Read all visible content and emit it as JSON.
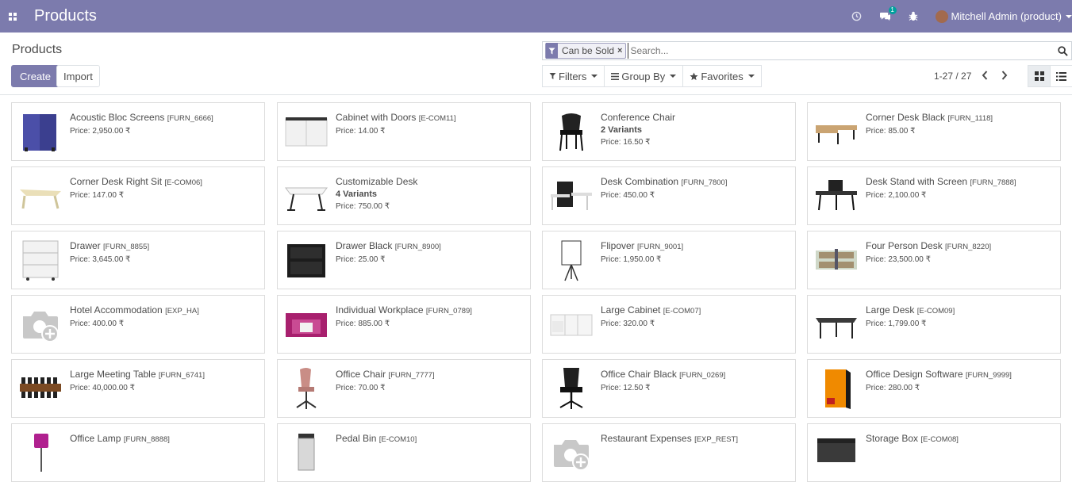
{
  "app_title": "Products",
  "nav": {
    "messages_badge": "1",
    "user_name": "Mitchell Admin (product)"
  },
  "control": {
    "breadcrumb": "Products",
    "create_label": "Create",
    "import_label": "Import",
    "search": {
      "facet_value": "Can be Sold",
      "facet_remove": "×",
      "placeholder": "Search..."
    },
    "filters_label": "Filters",
    "groupby_label": "Group By",
    "favorites_label": "Favorites",
    "pager": "1-27 / 27"
  },
  "colors": {
    "brand": "#7c7bad",
    "text": "#4c4c4c",
    "border": "#dcdcdc"
  },
  "products": [
    {
      "name": "Acoustic Bloc Screens",
      "ref": "[FURN_6666]",
      "variants": "",
      "price": "Price: 2,950.00 ₹",
      "image": "screen-panel"
    },
    {
      "name": "Cabinet with Doors",
      "ref": "[E-COM11]",
      "variants": "",
      "price": "Price: 14.00 ₹",
      "image": "cabinet"
    },
    {
      "name": "Conference Chair",
      "ref": "",
      "variants": "2 Variants",
      "price": "Price: 16.50 ₹",
      "image": "chair-black"
    },
    {
      "name": "Corner Desk Black",
      "ref": "[FURN_1118]",
      "variants": "",
      "price": "Price: 85.00 ₹",
      "image": "desk-wood"
    },
    {
      "name": "Corner Desk Right Sit",
      "ref": "[E-COM06]",
      "variants": "",
      "price": "Price: 147.00 ₹",
      "image": "desk-light"
    },
    {
      "name": "Customizable Desk",
      "ref": "",
      "variants": "4 Variants",
      "price": "Price: 750.00 ₹",
      "image": "desk-white"
    },
    {
      "name": "Desk Combination",
      "ref": "[FURN_7800]",
      "variants": "",
      "price": "Price: 450.00 ₹",
      "image": "desk-combo"
    },
    {
      "name": "Desk Stand with Screen",
      "ref": "[FURN_7888]",
      "variants": "",
      "price": "Price: 2,100.00 ₹",
      "image": "desk-screen"
    },
    {
      "name": "Drawer",
      "ref": "[FURN_8855]",
      "variants": "",
      "price": "Price: 3,645.00 ₹",
      "image": "drawer-white"
    },
    {
      "name": "Drawer Black",
      "ref": "[FURN_8900]",
      "variants": "",
      "price": "Price: 25.00 ₹",
      "image": "drawer-black"
    },
    {
      "name": "Flipover",
      "ref": "[FURN_9001]",
      "variants": "",
      "price": "Price: 1,950.00 ₹",
      "image": "flipover"
    },
    {
      "name": "Four Person Desk",
      "ref": "[FURN_8220]",
      "variants": "",
      "price": "Price: 23,500.00 ₹",
      "image": "four-desk"
    },
    {
      "name": "Hotel Accommodation",
      "ref": "[EXP_HA]",
      "variants": "",
      "price": "Price: 400.00 ₹",
      "image": "placeholder-camera"
    },
    {
      "name": "Individual Workplace",
      "ref": "[FURN_0789]",
      "variants": "",
      "price": "Price: 885.00 ₹",
      "image": "workplace-pink"
    },
    {
      "name": "Large Cabinet",
      "ref": "[E-COM07]",
      "variants": "",
      "price": "Price: 320.00 ₹",
      "image": "cabinet-large"
    },
    {
      "name": "Large Desk",
      "ref": "[E-COM09]",
      "variants": "",
      "price": "Price: 1,799.00 ₹",
      "image": "desk-large"
    },
    {
      "name": "Large Meeting Table",
      "ref": "[FURN_6741]",
      "variants": "",
      "price": "Price: 40,000.00 ₹",
      "image": "meeting-table"
    },
    {
      "name": "Office Chair",
      "ref": "[FURN_7777]",
      "variants": "",
      "price": "Price: 70.00 ₹",
      "image": "chair-pink"
    },
    {
      "name": "Office Chair Black",
      "ref": "[FURN_0269]",
      "variants": "",
      "price": "Price: 12.50 ₹",
      "image": "chair-office-black"
    },
    {
      "name": "Office Design Software",
      "ref": "[FURN_9999]",
      "variants": "",
      "price": "Price: 280.00 ₹",
      "image": "software-box"
    },
    {
      "name": "Office Lamp",
      "ref": "[FURN_8888]",
      "variants": "",
      "price": "",
      "image": "lamp"
    },
    {
      "name": "Pedal Bin",
      "ref": "[E-COM10]",
      "variants": "",
      "price": "",
      "image": "bin"
    },
    {
      "name": "Restaurant Expenses",
      "ref": "[EXP_REST]",
      "variants": "",
      "price": "",
      "image": "placeholder-camera"
    },
    {
      "name": "Storage Box",
      "ref": "[E-COM08]",
      "variants": "",
      "price": "",
      "image": "storage-box"
    }
  ]
}
